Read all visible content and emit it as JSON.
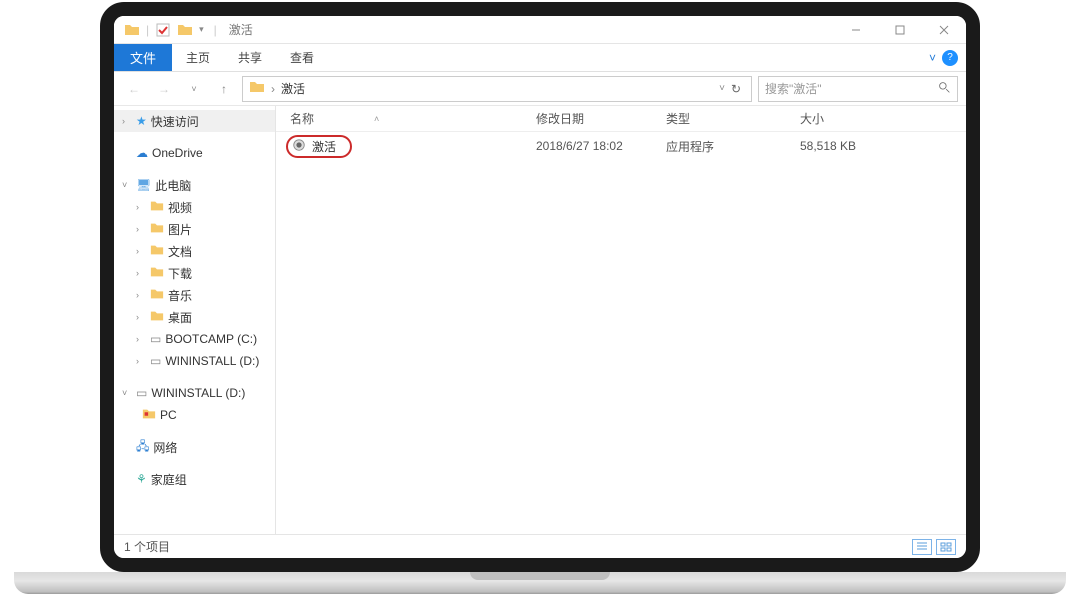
{
  "window": {
    "title": "激活"
  },
  "ribbon": {
    "file_tab": "文件",
    "tabs": [
      "主页",
      "共享",
      "查看"
    ]
  },
  "breadcrumb": {
    "folder": "激活",
    "search_placeholder": "搜索\"激活\""
  },
  "columns": {
    "name": "名称",
    "date": "修改日期",
    "type": "类型",
    "size": "大小"
  },
  "files": [
    {
      "name": "激活",
      "date": "2018/6/27 18:02",
      "type": "应用程序",
      "size": "58,518 KB"
    }
  ],
  "sidebar": {
    "quick_access": "快速访问",
    "onedrive": "OneDrive",
    "this_pc": "此电脑",
    "videos": "视频",
    "pictures": "图片",
    "documents": "文档",
    "downloads": "下载",
    "music": "音乐",
    "desktop": "桌面",
    "bootcamp": "BOOTCAMP (C:)",
    "wininstall": "WININSTALL (D:)",
    "wininstall2": "WININSTALL (D:)",
    "pc": "PC",
    "network": "网络",
    "homegroup": "家庭组"
  },
  "status": {
    "count": "1 个项目"
  }
}
